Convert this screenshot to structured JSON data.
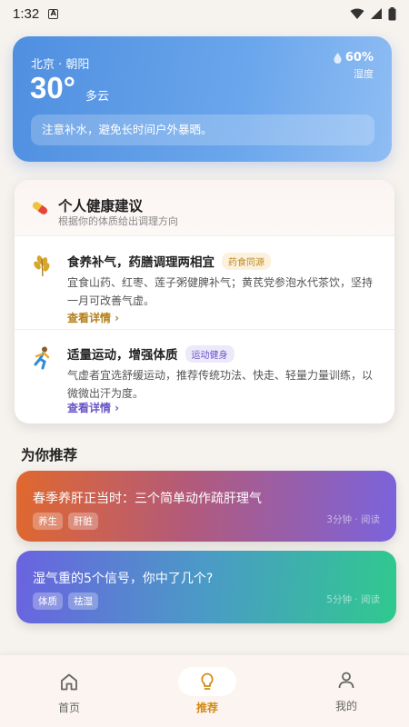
{
  "status_bar": {
    "time": "1:32",
    "notif_icon": "A"
  },
  "weather": {
    "location": "北京 · 朝阳",
    "temperature": "30°",
    "condition": "多云",
    "humidity_value": "60%",
    "humidity_label": "湿度",
    "tip": "注意补水，避免长时间户外暴晒。"
  },
  "health": {
    "title": "个人健康建议",
    "subtitle": "根据你的体质给出调理方向",
    "items": [
      {
        "title": "食养补气，药膳调理两相宜",
        "tag": "药食同源",
        "desc": "宜食山药、红枣、莲子粥健脾补气；黄芪党参泡水代茶饮，坚持一月可改善气虚。",
        "more": "查看详情 ›",
        "icon": "wheat-icon"
      },
      {
        "title": "适量运动，增强体质",
        "tag": "运动健身",
        "desc": "气虚者宜选舒缓运动，推荐传统功法、快走、轻量力量训练，以微微出汗为度。",
        "more": "查看详情 ›",
        "icon": "running-icon"
      }
    ]
  },
  "recommend": {
    "title": "为你推荐",
    "cards": [
      {
        "title": "春季养肝正当时：三个简单动作疏肝理气",
        "tags": [
          "养生",
          "肝脏"
        ],
        "meta": "3分钟 · 阅读"
      },
      {
        "title": "湿气重的5个信号，你中了几个?",
        "tags": [
          "体质",
          "祛湿"
        ],
        "meta": "5分钟 · 阅读"
      }
    ]
  },
  "nav": {
    "home": "首页",
    "recommend": "推荐",
    "me": "我的",
    "active": "recommend"
  },
  "colors": {
    "accent": "#d28a12",
    "weather": "#5b9ae5"
  }
}
